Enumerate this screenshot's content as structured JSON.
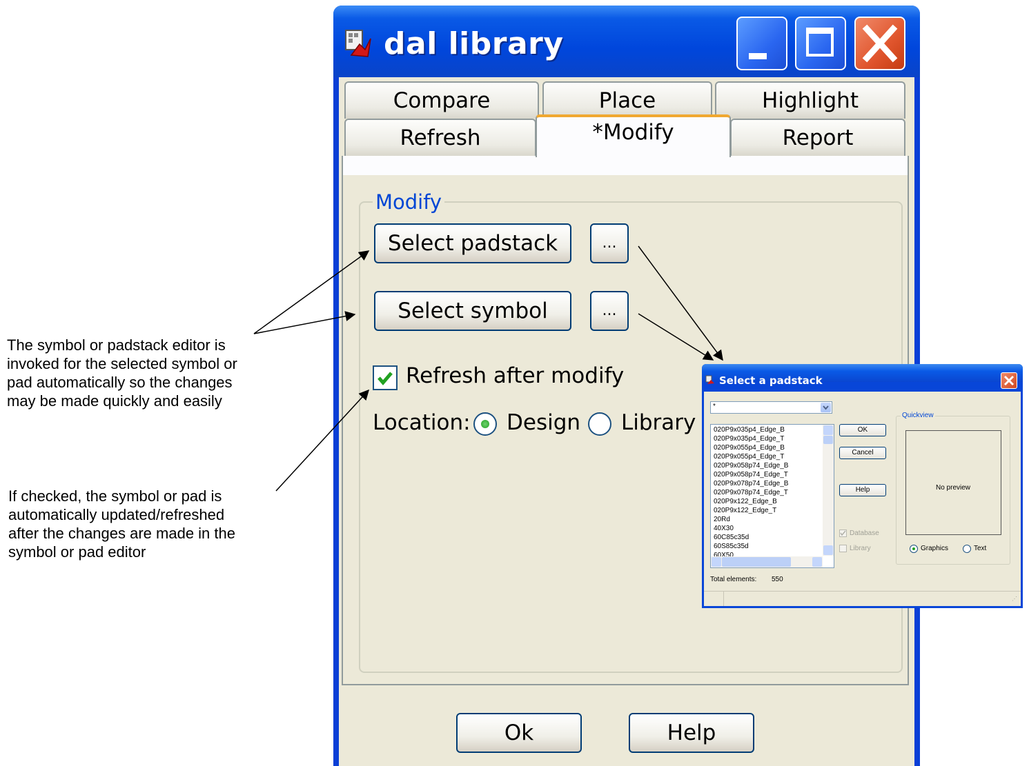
{
  "window": {
    "title": "dal library",
    "tabs_row1": [
      "Compare",
      "Place",
      "Highlight"
    ],
    "tabs_row2": [
      "Refresh",
      "*Modify",
      "Report"
    ],
    "group_title": "Modify",
    "select_padstack_label": "Select padstack",
    "select_symbol_label": "Select symbol",
    "ellipsis_label": "...",
    "refresh_checkbox_label": "Refresh after modify",
    "refresh_checked": true,
    "location_label": "Location:",
    "location_options": [
      "Design",
      "Library"
    ],
    "location_selected": "Design",
    "ok_label": "Ok",
    "help_label": "Help"
  },
  "annotations": {
    "editor_note": [
      "The symbol or padstack editor is",
      "invoked for the selected symbol or",
      "pad automatically so the changes",
      "may be made quickly and easily"
    ],
    "checkbox_note": [
      "If checked, the symbol or pad is",
      "automatically updated/refreshed",
      "after the changes are made in the",
      "symbol or pad editor"
    ]
  },
  "dialog": {
    "title": "Select a padstack",
    "filter_value": "*",
    "items": [
      "020P9x035p4_Edge_B",
      "020P9x035p4_Edge_T",
      "020P9x055p4_Edge_B",
      "020P9x055p4_Edge_T",
      "020P9x058p74_Edge_B",
      "020P9x058p74_Edge_T",
      "020P9x078p74_Edge_B",
      "020P9x078p74_Edge_T",
      "020P9x122_Edge_B",
      "020P9x122_Edge_T",
      "20Rd",
      "40X30",
      "60C85c35d",
      "60S85c35d",
      "60X50"
    ],
    "ok_label": "OK",
    "cancel_label": "Cancel",
    "help_label": "Help",
    "database_label": "Database",
    "library_label": "Library",
    "database_checked": true,
    "quickview_label": "Quickview",
    "no_preview_label": "No preview",
    "graphics_label": "Graphics",
    "text_label": "Text",
    "total_label": "Total elements:",
    "total_value": "550"
  },
  "colors": {
    "title_blue": "#0046dc",
    "client_bg": "#ece9d8",
    "accent_orange": "#f0a830",
    "close_red": "#e0552d"
  }
}
